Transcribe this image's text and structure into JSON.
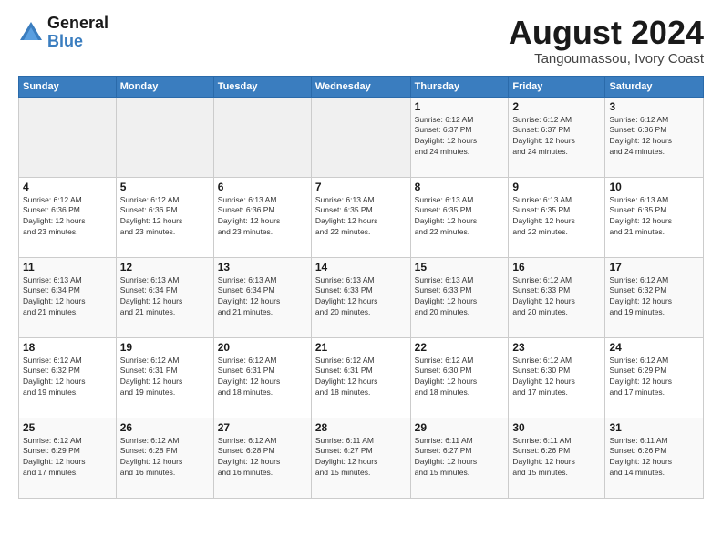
{
  "header": {
    "logo_general": "General",
    "logo_blue": "Blue",
    "month_year": "August 2024",
    "location": "Tangoumassou, Ivory Coast"
  },
  "calendar": {
    "days_of_week": [
      "Sunday",
      "Monday",
      "Tuesday",
      "Wednesday",
      "Thursday",
      "Friday",
      "Saturday"
    ],
    "weeks": [
      [
        {
          "day": "",
          "info": ""
        },
        {
          "day": "",
          "info": ""
        },
        {
          "day": "",
          "info": ""
        },
        {
          "day": "",
          "info": ""
        },
        {
          "day": "1",
          "info": "Sunrise: 6:12 AM\nSunset: 6:37 PM\nDaylight: 12 hours\nand 24 minutes."
        },
        {
          "day": "2",
          "info": "Sunrise: 6:12 AM\nSunset: 6:37 PM\nDaylight: 12 hours\nand 24 minutes."
        },
        {
          "day": "3",
          "info": "Sunrise: 6:12 AM\nSunset: 6:36 PM\nDaylight: 12 hours\nand 24 minutes."
        }
      ],
      [
        {
          "day": "4",
          "info": "Sunrise: 6:12 AM\nSunset: 6:36 PM\nDaylight: 12 hours\nand 23 minutes."
        },
        {
          "day": "5",
          "info": "Sunrise: 6:12 AM\nSunset: 6:36 PM\nDaylight: 12 hours\nand 23 minutes."
        },
        {
          "day": "6",
          "info": "Sunrise: 6:13 AM\nSunset: 6:36 PM\nDaylight: 12 hours\nand 23 minutes."
        },
        {
          "day": "7",
          "info": "Sunrise: 6:13 AM\nSunset: 6:35 PM\nDaylight: 12 hours\nand 22 minutes."
        },
        {
          "day": "8",
          "info": "Sunrise: 6:13 AM\nSunset: 6:35 PM\nDaylight: 12 hours\nand 22 minutes."
        },
        {
          "day": "9",
          "info": "Sunrise: 6:13 AM\nSunset: 6:35 PM\nDaylight: 12 hours\nand 22 minutes."
        },
        {
          "day": "10",
          "info": "Sunrise: 6:13 AM\nSunset: 6:35 PM\nDaylight: 12 hours\nand 21 minutes."
        }
      ],
      [
        {
          "day": "11",
          "info": "Sunrise: 6:13 AM\nSunset: 6:34 PM\nDaylight: 12 hours\nand 21 minutes."
        },
        {
          "day": "12",
          "info": "Sunrise: 6:13 AM\nSunset: 6:34 PM\nDaylight: 12 hours\nand 21 minutes."
        },
        {
          "day": "13",
          "info": "Sunrise: 6:13 AM\nSunset: 6:34 PM\nDaylight: 12 hours\nand 21 minutes."
        },
        {
          "day": "14",
          "info": "Sunrise: 6:13 AM\nSunset: 6:33 PM\nDaylight: 12 hours\nand 20 minutes."
        },
        {
          "day": "15",
          "info": "Sunrise: 6:13 AM\nSunset: 6:33 PM\nDaylight: 12 hours\nand 20 minutes."
        },
        {
          "day": "16",
          "info": "Sunrise: 6:12 AM\nSunset: 6:33 PM\nDaylight: 12 hours\nand 20 minutes."
        },
        {
          "day": "17",
          "info": "Sunrise: 6:12 AM\nSunset: 6:32 PM\nDaylight: 12 hours\nand 19 minutes."
        }
      ],
      [
        {
          "day": "18",
          "info": "Sunrise: 6:12 AM\nSunset: 6:32 PM\nDaylight: 12 hours\nand 19 minutes."
        },
        {
          "day": "19",
          "info": "Sunrise: 6:12 AM\nSunset: 6:31 PM\nDaylight: 12 hours\nand 19 minutes."
        },
        {
          "day": "20",
          "info": "Sunrise: 6:12 AM\nSunset: 6:31 PM\nDaylight: 12 hours\nand 18 minutes."
        },
        {
          "day": "21",
          "info": "Sunrise: 6:12 AM\nSunset: 6:31 PM\nDaylight: 12 hours\nand 18 minutes."
        },
        {
          "day": "22",
          "info": "Sunrise: 6:12 AM\nSunset: 6:30 PM\nDaylight: 12 hours\nand 18 minutes."
        },
        {
          "day": "23",
          "info": "Sunrise: 6:12 AM\nSunset: 6:30 PM\nDaylight: 12 hours\nand 17 minutes."
        },
        {
          "day": "24",
          "info": "Sunrise: 6:12 AM\nSunset: 6:29 PM\nDaylight: 12 hours\nand 17 minutes."
        }
      ],
      [
        {
          "day": "25",
          "info": "Sunrise: 6:12 AM\nSunset: 6:29 PM\nDaylight: 12 hours\nand 17 minutes."
        },
        {
          "day": "26",
          "info": "Sunrise: 6:12 AM\nSunset: 6:28 PM\nDaylight: 12 hours\nand 16 minutes."
        },
        {
          "day": "27",
          "info": "Sunrise: 6:12 AM\nSunset: 6:28 PM\nDaylight: 12 hours\nand 16 minutes."
        },
        {
          "day": "28",
          "info": "Sunrise: 6:11 AM\nSunset: 6:27 PM\nDaylight: 12 hours\nand 15 minutes."
        },
        {
          "day": "29",
          "info": "Sunrise: 6:11 AM\nSunset: 6:27 PM\nDaylight: 12 hours\nand 15 minutes."
        },
        {
          "day": "30",
          "info": "Sunrise: 6:11 AM\nSunset: 6:26 PM\nDaylight: 12 hours\nand 15 minutes."
        },
        {
          "day": "31",
          "info": "Sunrise: 6:11 AM\nSunset: 6:26 PM\nDaylight: 12 hours\nand 14 minutes."
        }
      ]
    ]
  }
}
